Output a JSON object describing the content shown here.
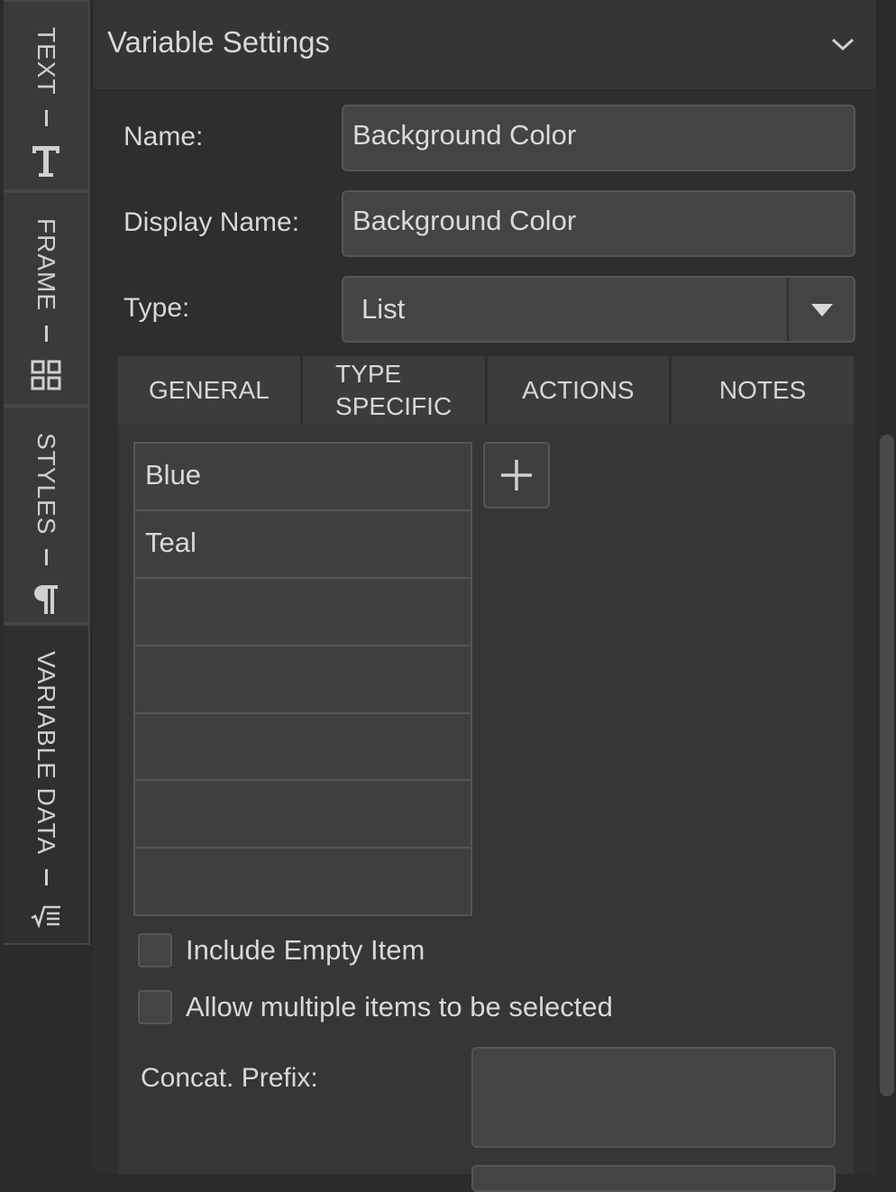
{
  "side_tabs": [
    {
      "label": "TEXT",
      "icon": "text-icon"
    },
    {
      "label": "FRAME",
      "icon": "grid-icon"
    },
    {
      "label": "STYLES",
      "icon": "pilcrow-icon"
    },
    {
      "label": "VARIABLE DATA",
      "icon": "formula-icon"
    }
  ],
  "header": {
    "title": "Variable Settings"
  },
  "form": {
    "name_label": "Name:",
    "name_value": "Background Color",
    "display_name_label": "Display Name:",
    "display_name_value": "Background Color",
    "type_label": "Type:",
    "type_value": "List"
  },
  "tabs": {
    "general": "GENERAL",
    "type_specific_line1": "TYPE",
    "type_specific_line2": "SPECIFIC",
    "actions": "ACTIONS",
    "notes": "NOTES"
  },
  "list": {
    "items": [
      "Blue",
      "Teal",
      "",
      "",
      "",
      "",
      ""
    ]
  },
  "options": {
    "include_empty_item": "Include Empty Item",
    "allow_multiple": "Allow multiple items to be selected",
    "concat_prefix_label": "Concat. Prefix:"
  },
  "colors": {
    "background": "#2b2b2b",
    "panel": "#2e2e2e",
    "field": "#444444",
    "text": "#d8d8d8"
  }
}
